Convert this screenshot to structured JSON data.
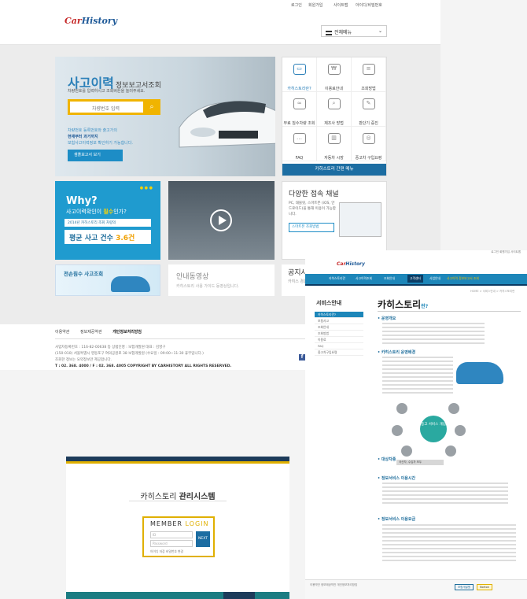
{
  "colors": {
    "brand_blue": "#1d86b9",
    "accent_yellow": "#f0b400",
    "dark_navy": "#1d3b5a"
  },
  "main": {
    "topbar": {
      "login": "로그인",
      "join": "회원가입",
      "sitemap": "사이트맵",
      "find": "아이디/비밀번호"
    },
    "logo": {
      "a": "Car",
      "b": "History"
    },
    "menu_select": "전체메뉴",
    "hero": {
      "title": "사고이력",
      "title_suffix": "정보보고서조회",
      "subtitle": "차량번호를 입력하시고 조회버튼을 눌러주세요.",
      "input_placeholder": "차량번호 입력",
      "note_line1": "차량번호 등록번호와 출고가의",
      "note_line2": "현재부터 과거까지",
      "note_line3": "보험사고이력정보 확인하기 가능합니다.",
      "sample_btn": "샘플보고서 보기"
    },
    "quick_menu": {
      "items": [
        "카히스토리란?",
        "이용료안내",
        "조회방법",
        "무료 침수차량 조회",
        "제조사 방법",
        "판단기 증진",
        "FAQ",
        "자동차 시장",
        "중고차 구입요령"
      ],
      "footer": "카히스토리 간편 메뉴"
    },
    "why": {
      "title": "Why?",
      "subtitle_a": "사고이력확인이 ",
      "subtitle_b": "필수",
      "subtitle_c": "인가?",
      "box": "2014년 카히스토리 조회 차량의",
      "stat_a": "평균 사고 건수 ",
      "stat_b": "3.6건"
    },
    "channel": {
      "title": "다양한 접속 채널",
      "desc": "PC, 태블릿, 스마트폰 (iOS, 안드로이드)을 통해 이용이 가능합니다.",
      "btn": "스마트폰 조회방법"
    },
    "banner_flood": "전손침수 사고조회",
    "video": {
      "title": "안내동영상",
      "desc": "카히스토리 사용 가이드 동영상입니다."
    },
    "notice": {
      "title": "공지사",
      "desc": "카히스 경품 행"
    },
    "footer": {
      "links": [
        "이용약관",
        "정보제공약관",
        "개인정보처리방침"
      ],
      "info1": "사업자등록번호 : 116-82-00638  등 상법인명 : 보험개발원 대표 : 김영구",
      "info2": "(150-010) 서울특별시 영등포구 여의공원로 38 보험개발원 (수요일 : 09:00~11:30 휴무입니다.)",
      "info3": "조회한 정보는 요약정보만 제공합니다.",
      "info4": "T : 02. 368. 4000 / F : 02. 368. 4005   COPYRIGHT BY CARHISTORY ALL RIGHTS RESERVED.",
      "fb": "f"
    }
  },
  "admin": {
    "title_a": "카히스토리 ",
    "title_b": "관리시스템",
    "login_title_a": "MEMBER ",
    "login_title_b": "LOGIN",
    "id_placeholder": "ID",
    "pw_placeholder": "Password",
    "login_btn": "NEXT",
    "options": "아이디 저장   비밀번호 변경"
  },
  "service": {
    "top_links": "로그인  회원가입  사이트맵",
    "logo_a": "Car",
    "logo_b": "History",
    "nav": [
      "카히스토리란",
      "사고이력조회",
      "조회안내",
      "고객센터",
      "사업안내"
    ],
    "nav_active": "사고이력 정보보고서 조회",
    "side_title": "서비스안내",
    "side_items": [
      "카히스토리란?",
      "보험사고",
      "조회안내",
      "조회방법",
      "이용료",
      "FAQ",
      "중고차구입요령"
    ],
    "heading": "카히스토리",
    "heading_suffix": "란?",
    "crumb": "HOME > 서비스안내 > 카히스토리란",
    "sections": [
      "• 운영개요",
      "• 카히스토리 운영배경",
      "• 대상차종",
      "• 정보서비스 이용시간",
      "• 정보서비스 이용요금"
    ],
    "hub": "중고 서비스 개념",
    "tag": "국산차, 수입차 모두",
    "footer": "이용약관   정보제공약관   개인정보처리방침",
    "badge1": "보험개발원",
    "badge2": "Norton"
  }
}
